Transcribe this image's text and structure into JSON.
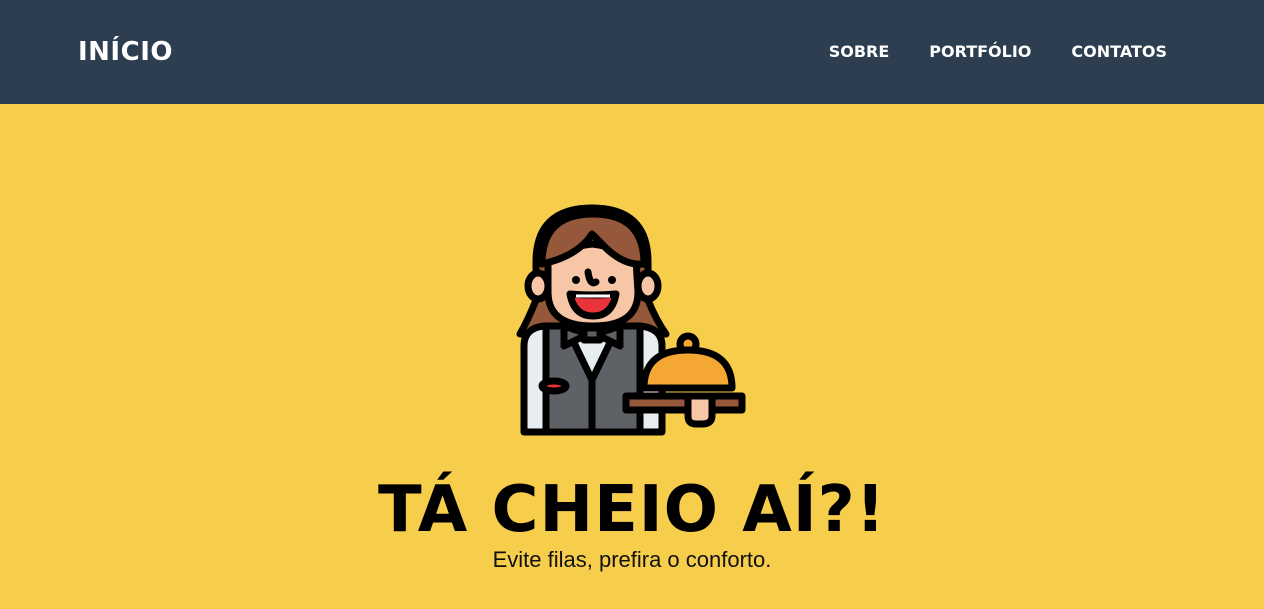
{
  "navbar": {
    "brand": "INÍCIO",
    "links": [
      "SOBRE",
      "PORTFÓLIO",
      "CONTATOS"
    ]
  },
  "hero": {
    "headline": "TÁ CHEIO AÍ?!",
    "subline": "Evite filas, prefira o conforto.",
    "image_icon": "waitress-with-cloche-icon"
  },
  "colors": {
    "navbar_bg": "#2c3e50",
    "hero_bg": "#f7cd4c",
    "text_light": "#ffffff",
    "text_dark": "#000000"
  }
}
